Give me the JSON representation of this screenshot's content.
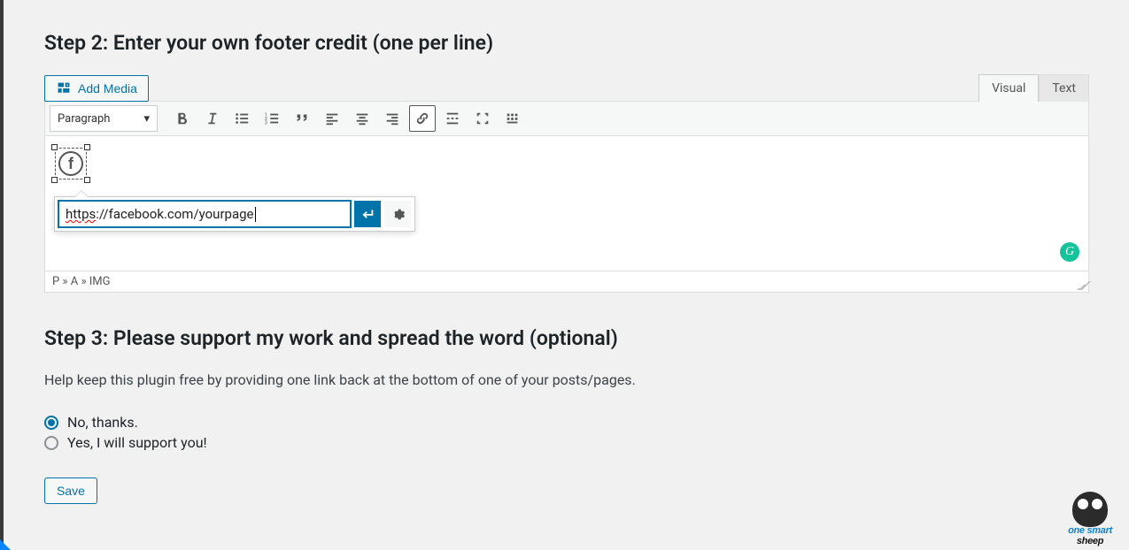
{
  "step2": {
    "heading": "Step 2: Enter your own footer credit (one per line)",
    "add_media_label": "Add Media",
    "tabs": {
      "visual": "Visual",
      "text": "Text",
      "active": "visual"
    },
    "format_select": "Paragraph",
    "link_url": "https://facebook.com/yourpage",
    "link_url_prefix_red": "https",
    "link_url_rest": "://facebook.com/yourpage",
    "breadcrumb": "P » A » IMG"
  },
  "step3": {
    "heading": "Step 3: Please support my work and spread the word (optional)",
    "help": "Help keep this plugin free by providing one link back at the bottom of one of your posts/pages.",
    "options": {
      "no": "No, thanks.",
      "yes": "Yes, I will support you!"
    },
    "selected": "no",
    "save_label": "Save"
  },
  "watermark": {
    "line1": "one smart",
    "line2": "sheep"
  }
}
